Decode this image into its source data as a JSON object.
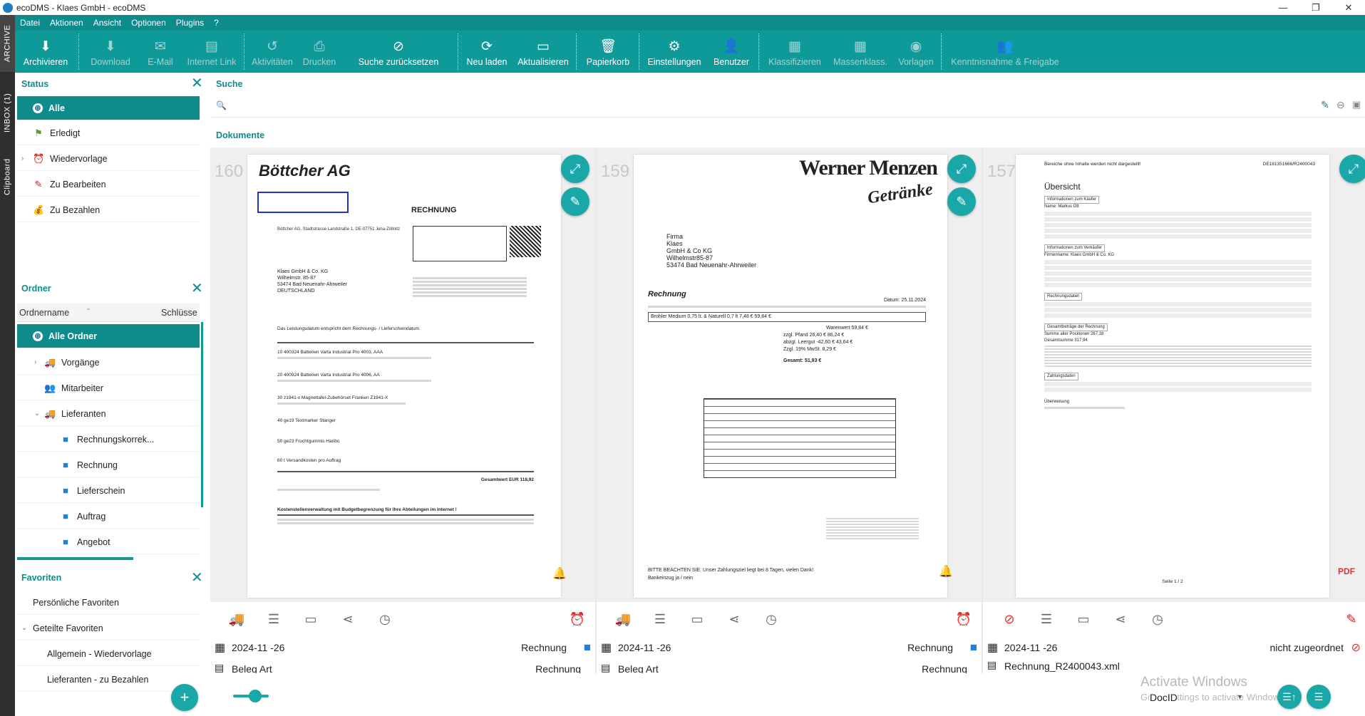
{
  "window": {
    "title": "ecoDMS - Klaes GmbH - ecoDMS",
    "controls": [
      "—",
      "❐",
      "✕"
    ]
  },
  "sidestrip": [
    "ARCHIVE",
    "INBOX (1)",
    "Clipboard"
  ],
  "menu": [
    "Datei",
    "Aktionen",
    "Ansicht",
    "Optionen",
    "Plugins",
    "?"
  ],
  "toolbar": [
    {
      "label": "Archivieren",
      "icon": "⬇",
      "enabled": true
    },
    {
      "label": "Download",
      "icon": "⬇",
      "enabled": false
    },
    {
      "label": "E-Mail",
      "icon": "✉",
      "enabled": false
    },
    {
      "label": "Internet Link",
      "icon": "▤",
      "enabled": false
    },
    {
      "label": "Aktivitäten",
      "icon": "↺",
      "enabled": false
    },
    {
      "label": "Drucken",
      "icon": "⎙",
      "enabled": false
    },
    {
      "label": "Suche zurücksetzen",
      "icon": "⊘",
      "enabled": true
    },
    {
      "label": "Neu laden",
      "icon": "⟳",
      "enabled": true
    },
    {
      "label": "Aktualisieren",
      "icon": "▭",
      "enabled": true
    },
    {
      "label": "Papierkorb",
      "icon": "🗑",
      "enabled": true
    },
    {
      "label": "Einstellungen",
      "icon": "⚙",
      "enabled": true
    },
    {
      "label": "Benutzer",
      "icon": "👤",
      "enabled": true
    },
    {
      "label": "Klassifizieren",
      "icon": "▦",
      "enabled": false
    },
    {
      "label": "Massenklass.",
      "icon": "▦",
      "enabled": false
    },
    {
      "label": "Vorlagen",
      "icon": "◉",
      "enabled": false
    },
    {
      "label": "Kenntnisnahme & Freigabe",
      "icon": "👥",
      "enabled": false
    }
  ],
  "status": {
    "title": "Status",
    "items": [
      {
        "label": "Alle",
        "icon": "⊕",
        "color": "#1d5f9a"
      },
      {
        "label": "Erledigt",
        "icon": "⚑",
        "color": "#5aa02c"
      },
      {
        "label": "Wiedervorlage",
        "icon": "⏰",
        "color": "#f08a24"
      },
      {
        "label": "Zu Bearbeiten",
        "icon": "✎",
        "color": "#d02020"
      },
      {
        "label": "Zu Bezahlen",
        "icon": "💰",
        "color": "#4a9a3a"
      }
    ]
  },
  "ordner": {
    "title": "Ordner",
    "col_name": "Ordnername",
    "col_key": "Schlüsse",
    "items": [
      {
        "label": "Alle Ordner",
        "icon": "⊕",
        "level": 0
      },
      {
        "label": "Vorgänge",
        "icon": "🚚",
        "level": 1,
        "chev": "›"
      },
      {
        "label": "Mitarbeiter",
        "icon": "👥",
        "level": 1
      },
      {
        "label": "Lieferanten",
        "icon": "🚚",
        "level": 1,
        "chev": "⌄"
      },
      {
        "label": "Rechnungskorrek...",
        "icon": "■",
        "level": 2
      },
      {
        "label": "Rechnung",
        "icon": "■",
        "level": 2
      },
      {
        "label": "Lieferschein",
        "icon": "■",
        "level": 2
      },
      {
        "label": "Auftrag",
        "icon": "■",
        "level": 2
      },
      {
        "label": "Angebot",
        "icon": "■",
        "level": 2
      }
    ]
  },
  "favoriten": {
    "title": "Favoriten",
    "items": [
      {
        "label": "Persönliche Favoriten",
        "level": 0
      },
      {
        "label": "Geteilte Favoriten",
        "level": 0,
        "chev": "⌄"
      },
      {
        "label": "Allgemein - Wiedervorlage",
        "level": 1
      },
      {
        "label": "Lieferanten - zu Bezahlen",
        "level": 1
      }
    ],
    "add": "+"
  },
  "search": {
    "title": "Suche",
    "placeholder": "",
    "icon": "🔍"
  },
  "documents": {
    "title": "Dokumente",
    "cards": [
      {
        "num": "160",
        "date": "2024-11 -26",
        "type": "Rechnung",
        "meta2_label": "Beleg Art",
        "meta2_value": "Rechnung",
        "status_icon": "⏰",
        "header": "Böttcher AG",
        "doc_title": "RECHNUNG",
        "sender": "Böttcher AG, Stadtstrasse Landstraße 1, DE-07751 Jena-Zöllnitz",
        "recipient": [
          "Klaes GmbH & Co. KG",
          "Wilhelmstr. 85-87",
          "53474 Bad Neuenahr-Ahrweiler",
          "DEUTSCHLAND"
        ],
        "lines": [
          "Das Leistungsdatum entspricht dem Rechnungs- / Lieferscheindatum.",
          "10 400324 Batterien Varta Industrial Pro 4003, AAA",
          "20 400924 Batterien Varta Industrial Pro 4006, AA",
          "30 z1941-x Magnettafel-Zubehörset Franken Z1941-X",
          "40 ge19 Textmarker Stanger",
          "50 ge23 Fruchtgummis Haribo",
          "60 t Versandkosten pro Auftrag",
          "Gesamtwert EUR 118,92",
          "Kostenstellenverwaltung mit Budgetbegrenzung für Ihre Abteilungen im Internet !"
        ]
      },
      {
        "num": "159",
        "date": "2024-11 -26",
        "type": "Rechnung",
        "meta2_label": "Beleg Art",
        "meta2_value": "Rechnung",
        "status_icon": "⏰",
        "header": "Werner Menzen",
        "header2": "Getränke",
        "doc_title": "Rechnung",
        "recipient": [
          "Firma",
          "Klaes",
          "GmbH & Co KG",
          "Wilhelmstr85-87",
          "53474 Bad Neuenahr-Ahrweiler"
        ],
        "lines": [
          "Datum: 25.11.2024",
          "Brohler Medium 0,75 lt. & Naturell 0,7 lt   7,48 €   59,84 €",
          "Warenwert 59,84 €",
          "zzgl. Pfand 26,40 € 86,24 €",
          "abzgl. Leergut -42,60 € 43,64 €",
          "Zzgl. 19% MwSt. 8,29 €",
          "Gesamt: 51,93 €",
          "BITTE BEACHTEN SIE: Unser Zahlungsziel liegt bei 8 Tagen, vielen Dank!",
          "Bankeinzug ja / nein"
        ]
      },
      {
        "num": "157",
        "date": "2024-11 -26",
        "type": "nicht zugeordnet",
        "meta2_label": "Rechnung_R2400043.xml",
        "meta2_value": "",
        "status_icon": "⊘",
        "header": "Bereiche ohne Inhalte werden nicht dargestellt!",
        "header_right": "DE181351666/R2400043",
        "doc_title": "Übersicht",
        "lines": [
          "Informationen zum Käufer",
          "Name: Markus Ott",
          "Informationen zum Verkäufer",
          "Firmenname: Klaes GmbH & Co. KG",
          "Rechnungsdaten",
          "Gesamtbeträge der Rechnung",
          "Summe aller Positionen 267,18",
          "Gesamtsumme 317,94",
          "Zahlungsdaten",
          "Überweisung",
          "Seite 1 / 2"
        ]
      }
    ]
  },
  "watermark": {
    "line1": "Activate Windows",
    "line2": "Go to Settings to activate Windows."
  },
  "sort": {
    "label": "DocID"
  },
  "slider": {
    "value": 0.62
  },
  "colors": {
    "teal": "#0f9a9a",
    "teal_dark": "#0e8c8c"
  }
}
